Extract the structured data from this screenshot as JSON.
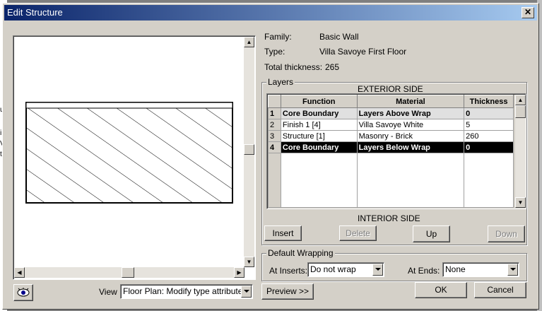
{
  "window": {
    "title": "Edit Structure",
    "close_glyph": "✕"
  },
  "info": {
    "family_label": "Family:",
    "family_value": "Basic Wall",
    "type_label": "Type:",
    "type_value": "Villa Savoye First Floor",
    "thickness_label": "Total thickness:",
    "thickness_value": "265"
  },
  "layers": {
    "group_title": "Layers",
    "exterior_label": "EXTERIOR SIDE",
    "interior_label": "INTERIOR SIDE",
    "columns": [
      "Function",
      "Material",
      "Thickness"
    ],
    "rows": [
      {
        "num": "1",
        "function": "Core Boundary",
        "material": "Layers Above Wrap",
        "thickness": "0"
      },
      {
        "num": "2",
        "function": "Finish 1 [4]",
        "material": "Villa Savoye White",
        "thickness": "5"
      },
      {
        "num": "3",
        "function": "Structure  [1]",
        "material": "Masonry - Brick",
        "thickness": "260"
      },
      {
        "num": "4",
        "function": "Core Boundary",
        "material": "Layers Below Wrap",
        "thickness": "0"
      }
    ]
  },
  "buttons": {
    "insert": "Insert",
    "delete": "Delete",
    "up": "Up",
    "down": "Down",
    "preview": "Preview >>",
    "ok": "OK",
    "cancel": "Cancel"
  },
  "wrapping": {
    "group_title": "Default Wrapping",
    "inserts_label": "At Inserts:",
    "inserts_value": "Do not wrap",
    "ends_label": "At  Ends:",
    "ends_value": "None"
  },
  "view": {
    "label": "View",
    "value": "Floor Plan: Modify type attributes"
  },
  "background_text": [
    "us",
    "ir",
    "V",
    "ti"
  ]
}
